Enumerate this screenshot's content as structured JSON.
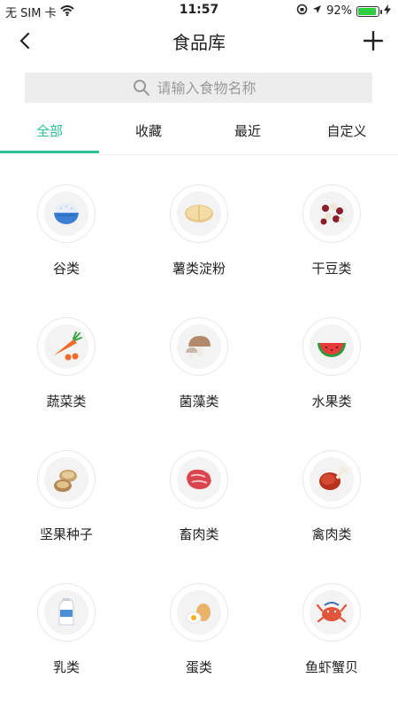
{
  "status_bar": {
    "carrier": "无 SIM 卡",
    "time": "11:57",
    "battery_percent": "92%",
    "battery_level": 0.92
  },
  "nav": {
    "title": "食品库",
    "back_icon": "chevron-left-icon",
    "add_icon": "plus-icon"
  },
  "search": {
    "placeholder": "请输入食物名称",
    "value": ""
  },
  "tabs": [
    {
      "label": "全部",
      "active": true
    },
    {
      "label": "收藏",
      "active": false
    },
    {
      "label": "最近",
      "active": false
    },
    {
      "label": "自定义",
      "active": false
    }
  ],
  "accent_color": "#2bbf94",
  "categories": [
    {
      "label": "谷类",
      "icon": "rice-bowl-icon"
    },
    {
      "label": "薯类淀粉",
      "icon": "potato-slices-icon"
    },
    {
      "label": "干豆类",
      "icon": "dried-beans-icon"
    },
    {
      "label": "蔬菜类",
      "icon": "carrot-icon"
    },
    {
      "label": "菌藻类",
      "icon": "mushroom-icon"
    },
    {
      "label": "水果类",
      "icon": "watermelon-icon"
    },
    {
      "label": "坚果种子",
      "icon": "nuts-icon"
    },
    {
      "label": "畜肉类",
      "icon": "red-meat-icon"
    },
    {
      "label": "禽肉类",
      "icon": "drumstick-icon"
    },
    {
      "label": "乳类",
      "icon": "milk-carton-icon"
    },
    {
      "label": "蛋类",
      "icon": "eggs-icon"
    },
    {
      "label": "鱼虾蟹贝",
      "icon": "seafood-icon"
    }
  ]
}
